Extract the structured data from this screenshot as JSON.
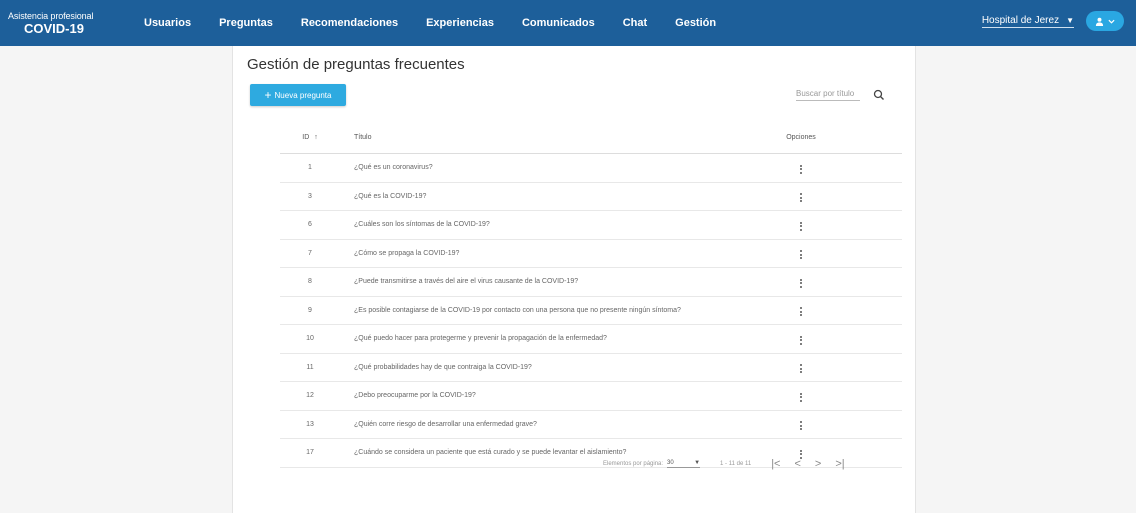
{
  "brand": {
    "line1": "Asistencia profesional",
    "line2": "COVID-19"
  },
  "nav": [
    {
      "label": "Usuarios"
    },
    {
      "label": "Preguntas"
    },
    {
      "label": "Recomendaciones"
    },
    {
      "label": "Experiencias"
    },
    {
      "label": "Comunicados"
    },
    {
      "label": "Chat"
    },
    {
      "label": "Gestión"
    }
  ],
  "hospital": {
    "selected": "Hospital de Jerez"
  },
  "page": {
    "title": "Gestión de preguntas frecuentes"
  },
  "new_button": {
    "label": "Nueva pregunta"
  },
  "search": {
    "placeholder": "Buscar por título"
  },
  "table": {
    "headers": {
      "id": "ID",
      "title": "Título",
      "options": "Opciones"
    },
    "rows": [
      {
        "id": "1",
        "title": "¿Qué es un coronavirus?"
      },
      {
        "id": "3",
        "title": "¿Qué es la COVID-19?"
      },
      {
        "id": "6",
        "title": "¿Cuáles son los síntomas de la COVID-19?"
      },
      {
        "id": "7",
        "title": "¿Cómo se propaga la COVID-19?"
      },
      {
        "id": "8",
        "title": "¿Puede transmitirse a través del aire el virus causante de la COVID-19?"
      },
      {
        "id": "9",
        "title": "¿Es posible contagiarse de la COVID-19 por contacto con una persona que no presente ningún síntoma?"
      },
      {
        "id": "10",
        "title": "¿Qué puedo hacer para protegerme y prevenir la propagación de la enfermedad?"
      },
      {
        "id": "11",
        "title": "¿Qué probabilidades hay de que contraiga la COVID-19?"
      },
      {
        "id": "12",
        "title": "¿Debo preocuparme por la COVID-19?"
      },
      {
        "id": "13",
        "title": "¿Quién corre riesgo de desarrollar una enfermedad grave?"
      },
      {
        "id": "17",
        "title": "¿Cuándo se considera un paciente que está curado y se puede levantar el aislamiento?"
      }
    ]
  },
  "pagination": {
    "per_page_label": "Elementos por página:",
    "per_page_value": "30",
    "range": "1 - 11 de 11"
  },
  "colors": {
    "topbar": "#1d5f9a",
    "accent": "#2eaae0"
  },
  "icons": [
    "sort-up-icon",
    "search-icon",
    "plus-icon",
    "kebab-menu-icon",
    "user-icon",
    "chevron-down-icon",
    "first-page-icon",
    "prev-page-icon",
    "next-page-icon",
    "last-page-icon"
  ]
}
